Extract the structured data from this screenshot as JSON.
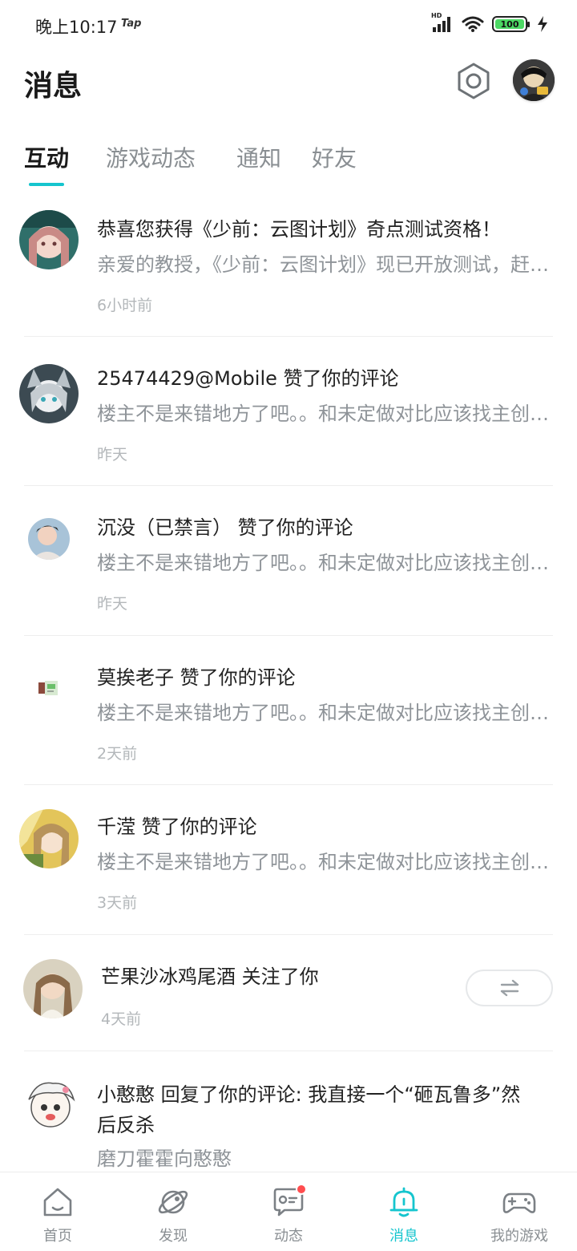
{
  "status_bar": {
    "time": "晚上10:17",
    "tap_label": "Tap",
    "hd_label": "HD",
    "battery": "100"
  },
  "header": {
    "title": "消息"
  },
  "tabs": [
    {
      "label": "互动",
      "active": true
    },
    {
      "label": "游戏动态",
      "active": false
    },
    {
      "label": "通知",
      "active": false
    },
    {
      "label": "好友",
      "active": false
    }
  ],
  "messages": [
    {
      "title": "恭喜您获得《少前：云图计划》奇点测试资格！",
      "body": "亲爱的教授，《少前：云图计划》现已开放测试，赶紧来体验吧",
      "time": "6小时前"
    },
    {
      "title": "25474429@Mobile 赞了你的评论",
      "body": "楼主不是来错地方了吧。。和未定做对比应该找主创聊聊",
      "time": "昨天"
    },
    {
      "title": "沉没（已禁言） 赞了你的评论",
      "body": "楼主不是来错地方了吧。。和未定做对比应该找主创聊聊",
      "time": "昨天"
    },
    {
      "title": "莫挨老子 赞了你的评论",
      "body": "楼主不是来错地方了吧。。和未定做对比应该找主创聊聊",
      "time": "2天前"
    },
    {
      "title": "千滢 赞了你的评论",
      "body": "楼主不是来错地方了吧。。和未定做对比应该找主创聊聊",
      "time": "3天前"
    },
    {
      "title": "芒果沙冰鸡尾酒 关注了你",
      "time": "4天前"
    },
    {
      "title_line1": "小憨憨 回复了你的评论: 我直接一个“砸瓦鲁多”然",
      "title_line2": "后反杀",
      "body": "磨刀霍霍向憨憨"
    }
  ],
  "bottom_nav": [
    {
      "label": "首页",
      "icon": "home-icon"
    },
    {
      "label": "发现",
      "icon": "planet-icon"
    },
    {
      "label": "动态",
      "icon": "chat-icon"
    },
    {
      "label": "消息",
      "icon": "bell-icon",
      "active": true
    },
    {
      "label": "我的游戏",
      "icon": "gamepad-icon"
    }
  ],
  "colors": {
    "accent": "#15c5ce",
    "badge": "#ff4d4f",
    "secondary_text": "#8f9499",
    "time_text": "#b3b7ba"
  }
}
